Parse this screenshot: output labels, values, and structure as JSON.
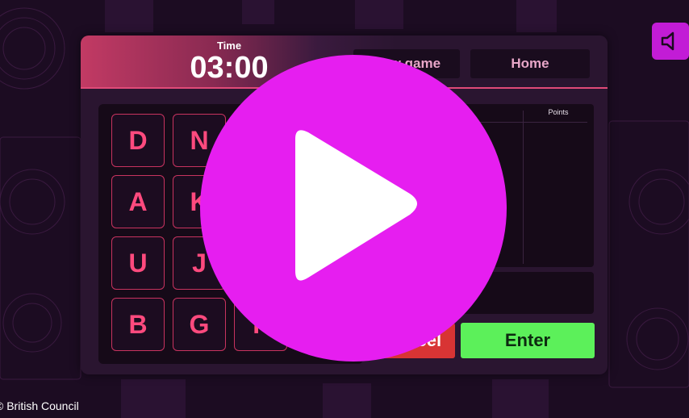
{
  "timer": {
    "label": "Time",
    "value": "03:00"
  },
  "top_buttons": {
    "new_game": "New game",
    "home": "Home"
  },
  "tiles": [
    "D",
    "N",
    "",
    "",
    "A",
    "K",
    "",
    "",
    "U",
    "J",
    "",
    "",
    "B",
    "G",
    "F",
    ""
  ],
  "words": {
    "points_header": "Points"
  },
  "actions": {
    "cancel": "Cancel",
    "enter": "Enter"
  },
  "footer": {
    "copyright": "© British Council"
  },
  "colors": {
    "accent": "#e61ef0",
    "tile_text": "#ff4a7e",
    "enter": "#5cf05a",
    "cancel": "#d83434",
    "panel": "#2a1530"
  },
  "icons": {
    "sound": "speaker-icon",
    "play": "play-icon"
  }
}
